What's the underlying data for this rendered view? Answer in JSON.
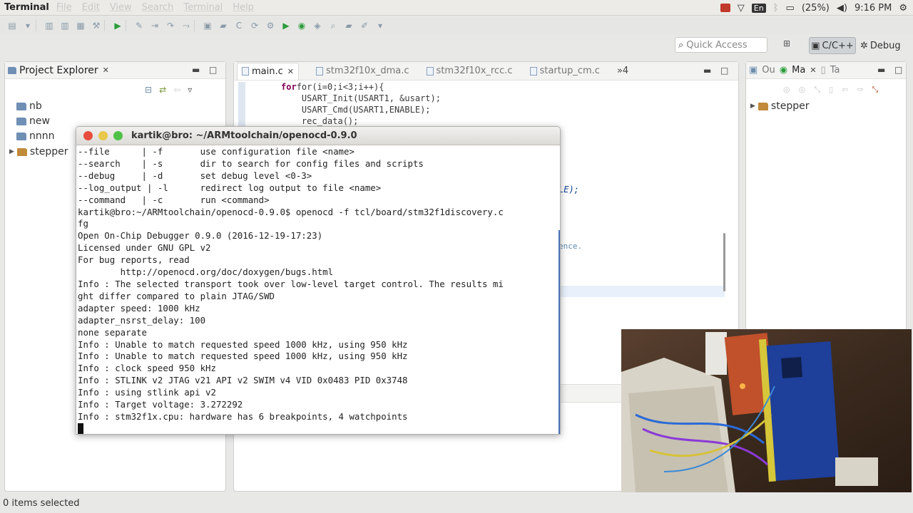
{
  "topbar": {
    "app": "Terminal",
    "menus": [
      "File",
      "Edit",
      "View",
      "Search",
      "Terminal",
      "Help"
    ],
    "lang": "En",
    "battery": "(25%)",
    "time": "9:16 PM"
  },
  "toolbar": {
    "quick_access_placeholder": "Quick Access",
    "perspectives": [
      "C/C++",
      "Debug"
    ]
  },
  "project_explorer": {
    "title": "Project Explorer",
    "items": [
      "nb",
      "new",
      "nnnn",
      "stepper"
    ]
  },
  "editor": {
    "tabs": [
      "main.c",
      "stm32f10x_dma.c",
      "stm32f10x_rcc.c",
      "startup_cm.c"
    ],
    "overflow": "»4",
    "code_lines": [
      "for(i=0;i<3;i++){",
      "    USART_Init(USART1, &usart);",
      "    USART_Cmd(USART1,ENABLE);",
      "    rec_data();"
    ],
    "code_fragment_1": "LE);",
    "code_fragment_2": "ence."
  },
  "outline": {
    "tabs": [
      "Ou",
      "Ma",
      "Ta"
    ],
    "items": [
      "stepper"
    ]
  },
  "terminal": {
    "title": "kartik@bro: ~/ARMtoolchain/openocd-0.9.0",
    "lines": [
      "--file      | -f       use configuration file <name>",
      "--search    | -s       dir to search for config files and scripts",
      "--debug     | -d       set debug level <0-3>",
      "--log_output | -l      redirect log output to file <name>",
      "--command   | -c       run <command>",
      "kartik@bro:~/ARMtoolchain/openocd-0.9.0$ openocd -f tcl/board/stm32f1discovery.c",
      "fg",
      "Open On-Chip Debugger 0.9.0 (2016-12-19-17:23)",
      "Licensed under GNU GPL v2",
      "For bug reports, read",
      "        http://openocd.org/doc/doxygen/bugs.html",
      "Info : The selected transport took over low-level target control. The results mi",
      "ght differ compared to plain JTAG/SWD",
      "adapter speed: 1000 kHz",
      "adapter_nsrst_delay: 100",
      "none separate",
      "Info : Unable to match requested speed 1000 kHz, using 950 kHz",
      "Info : Unable to match requested speed 1000 kHz, using 950 kHz",
      "Info : clock speed 950 kHz",
      "Info : STLINK v2 JTAG v21 API v2 SWIM v4 VID 0x0483 PID 0x3748",
      "Info : using stlink api v2",
      "Info : Target voltage: 3.272292",
      "Info : stm32f1x.cpu: hardware has 6 breakpoints, 4 watchpoints"
    ]
  },
  "status": {
    "text": "0 items selected"
  }
}
